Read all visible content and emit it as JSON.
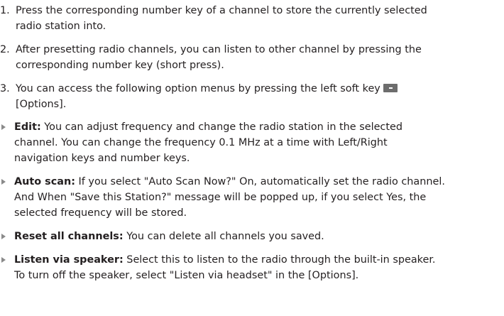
{
  "numbered": [
    {
      "num": "1.",
      "lines": [
        "Press the corresponding number key of a channel to store the currently selected",
        "radio station into."
      ]
    },
    {
      "num": "2.",
      "lines": [
        "After presetting radio channels, you can listen to other channel by pressing the",
        "corresponding number key (short press)."
      ]
    },
    {
      "num": "3.",
      "lines": [
        "You can access the following option menus by pressing the left soft key",
        "[Options]."
      ]
    }
  ],
  "bullets": [
    {
      "term": "Edit:",
      "lines": [
        " You can adjust frequency and change the radio station in the selected",
        "channel. You can change the frequency 0.1 MHz at a time with Left/Right",
        "navigation keys and number keys."
      ]
    },
    {
      "term": "Auto scan:",
      "lines": [
        " If you select \"Auto Scan Now?\" On, automatically set the radio channel.",
        "And When \"Save this Station?\" message will be popped up, if you select Yes, the",
        "selected frequency will be stored."
      ]
    },
    {
      "term": "Reset all channels:",
      "lines": [
        " You can delete all channels you saved."
      ]
    },
    {
      "term": "Listen via speaker:",
      "lines": [
        " Select this to listen to the radio through the built-in speaker.",
        "To turn off the speaker, select \"Listen via headset\" in the [Options]."
      ]
    }
  ],
  "icons": {
    "softkey": "left-soft-key-icon"
  }
}
